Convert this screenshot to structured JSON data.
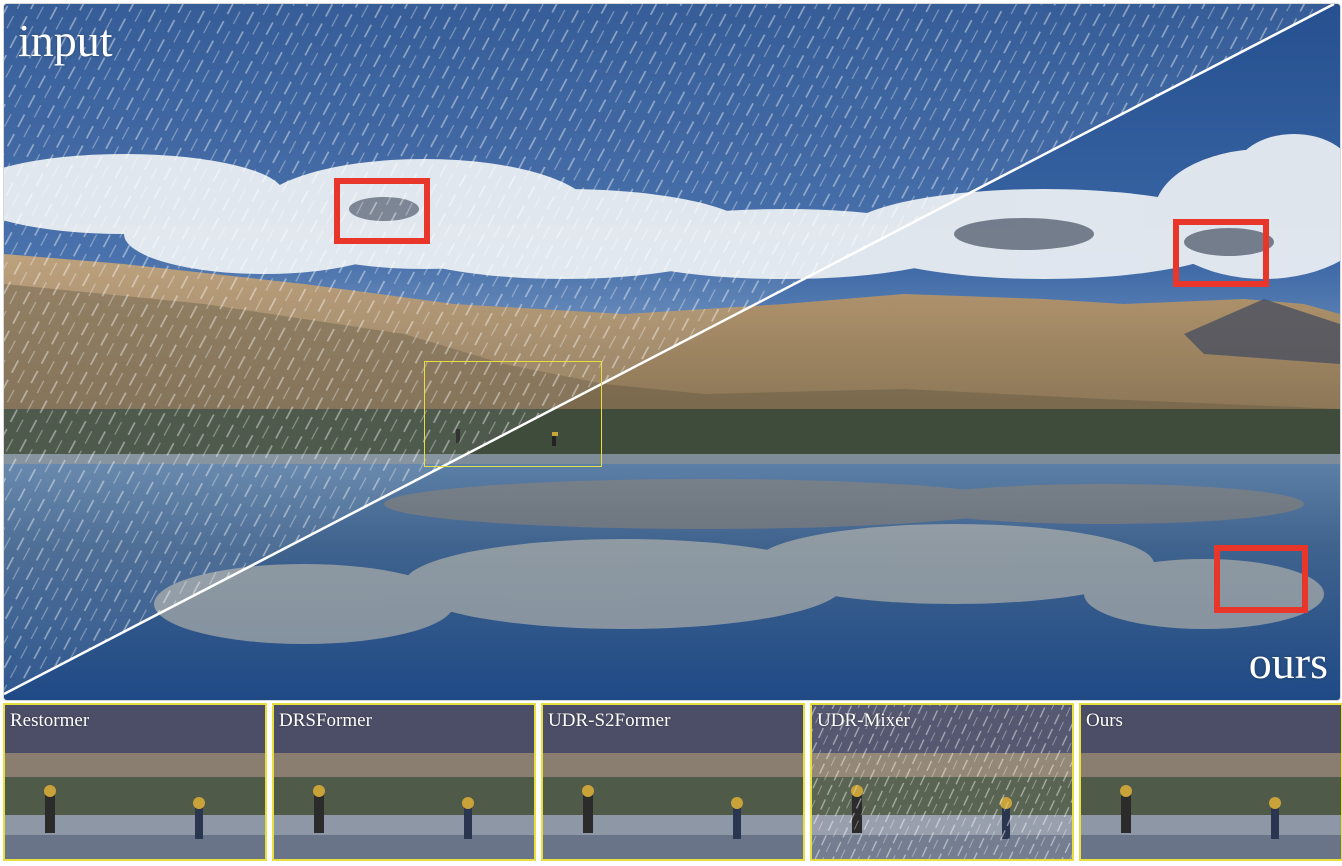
{
  "main": {
    "label_input": "input",
    "label_ours": "ours"
  },
  "thumbnails": [
    {
      "label": "Restormer",
      "rainy": false
    },
    {
      "label": "DRSFormer",
      "rainy": false
    },
    {
      "label": "UDR-S2Former",
      "rainy": false
    },
    {
      "label": "UDR-Mixer",
      "rainy": true
    },
    {
      "label": "Ours",
      "rainy": false
    }
  ],
  "colors": {
    "highlight_box": "#e8362a",
    "zoom_box": "#e6df3e",
    "divider": "#ffffff",
    "sky": "#2d5694",
    "water": "#2a5289"
  }
}
